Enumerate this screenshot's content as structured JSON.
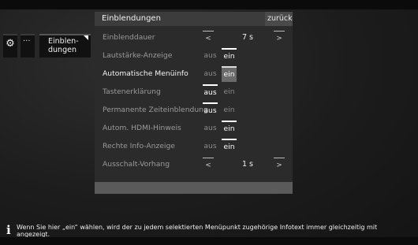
{
  "breadcrumb": {
    "icon": "gear-icon",
    "dots": "···",
    "current": "Einblen-\ndungen"
  },
  "panel": {
    "title": "Einblendungen",
    "back_label": "zurück"
  },
  "rows": [
    {
      "label": "Einblenddauer",
      "type": "value",
      "left": "<",
      "value": "7 s",
      "right": ">"
    },
    {
      "label": "Lautstärke-Anzeige",
      "type": "toggle",
      "aus": "aus",
      "ein": "ein",
      "selected": "ein"
    },
    {
      "label": "Automatische Menüinfo",
      "type": "toggle",
      "aus": "aus",
      "ein": "ein",
      "selected": "ein",
      "focused": true
    },
    {
      "label": "Tastenerklärung",
      "type": "toggle",
      "aus": "aus",
      "ein": "ein",
      "selected": "aus"
    },
    {
      "label": "Permanente Zeiteinblendung",
      "type": "toggle",
      "aus": "aus",
      "ein": "ein",
      "selected": "aus"
    },
    {
      "label": "Autom. HDMI-Hinweis",
      "type": "toggle",
      "aus": "aus",
      "ein": "ein",
      "selected": "ein"
    },
    {
      "label": "Rechte Info-Anzeige",
      "type": "toggle",
      "aus": "aus",
      "ein": "ein",
      "selected": "ein"
    },
    {
      "label": "Ausschalt-Vorhang",
      "type": "value",
      "left": "<",
      "value": "1 s",
      "right": ">"
    }
  ],
  "info": {
    "icon": "info-icon",
    "glyph": "i",
    "text": "Wenn Sie hier „ein“ wählen, wird der zu jedem selektierten Menüpunkt zugehörige Infotext immer gleichzeitig mit angezeigt."
  }
}
